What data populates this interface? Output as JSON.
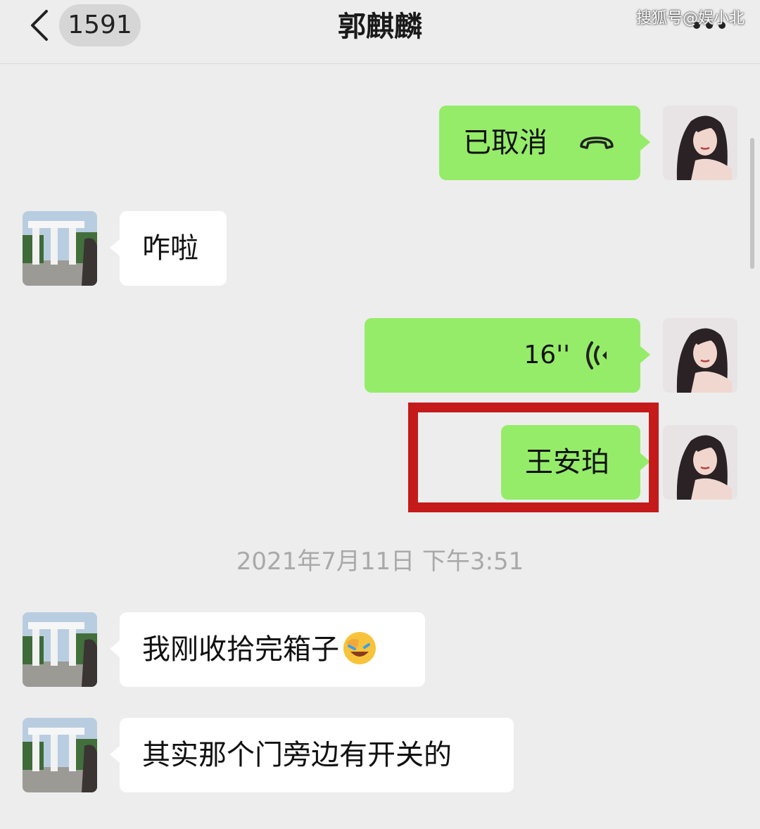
{
  "header": {
    "unread_count": "1591",
    "title": "郭麒麟",
    "watermark": "搜狐号@娱小北"
  },
  "messages": [
    {
      "side": "out",
      "type": "call",
      "text": "已取消",
      "icon": "phone-hangup-icon"
    },
    {
      "side": "in",
      "type": "text",
      "text": "咋啦"
    },
    {
      "side": "out",
      "type": "voice",
      "text": "16''",
      "icon": "voice-wave-icon"
    },
    {
      "side": "out",
      "type": "text",
      "text": "王安珀",
      "highlighted": true
    },
    {
      "side": "in",
      "type": "text",
      "text": "我刚收拾完箱子",
      "icon": "facepalm-emoji-icon"
    },
    {
      "side": "in",
      "type": "text",
      "text": "其实那个门旁边有开关的"
    }
  ],
  "timestamp": "2021年7月11日 下午3:51",
  "colors": {
    "background": "#ededed",
    "outgoing_bubble": "#95ec69",
    "incoming_bubble": "#ffffff",
    "highlight": "#c41a1a"
  }
}
